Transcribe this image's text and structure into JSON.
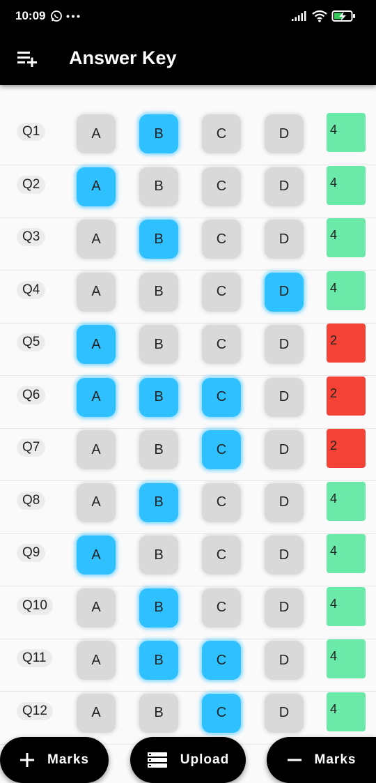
{
  "status_bar": {
    "time": "10:09"
  },
  "app_bar": {
    "title": "Answer Key"
  },
  "options": [
    "A",
    "B",
    "C",
    "D"
  ],
  "colors": {
    "selected": "#2ec0ff",
    "unselected": "#d9d9d9",
    "mark_high": "#6ae9a8",
    "mark_low": "#f44336"
  },
  "questions": [
    {
      "label": "Q1",
      "selected": [
        "B"
      ],
      "mark": "4"
    },
    {
      "label": "Q2",
      "selected": [
        "A"
      ],
      "mark": "4"
    },
    {
      "label": "Q3",
      "selected": [
        "B"
      ],
      "mark": "4"
    },
    {
      "label": "Q4",
      "selected": [
        "D"
      ],
      "mark": "4"
    },
    {
      "label": "Q5",
      "selected": [
        "A"
      ],
      "mark": "2"
    },
    {
      "label": "Q6",
      "selected": [
        "A",
        "B",
        "C"
      ],
      "mark": "2"
    },
    {
      "label": "Q7",
      "selected": [
        "C"
      ],
      "mark": "2"
    },
    {
      "label": "Q8",
      "selected": [
        "B"
      ],
      "mark": "4"
    },
    {
      "label": "Q9",
      "selected": [
        "A"
      ],
      "mark": "4"
    },
    {
      "label": "Q10",
      "selected": [
        "B"
      ],
      "mark": "4"
    },
    {
      "label": "Q11",
      "selected": [
        "B",
        "C"
      ],
      "mark": "4"
    },
    {
      "label": "Q12",
      "selected": [
        "C"
      ],
      "mark": "4"
    }
  ],
  "fabs": {
    "add_marks": "Marks",
    "upload": "Upload",
    "subtract_marks": "Marks"
  }
}
